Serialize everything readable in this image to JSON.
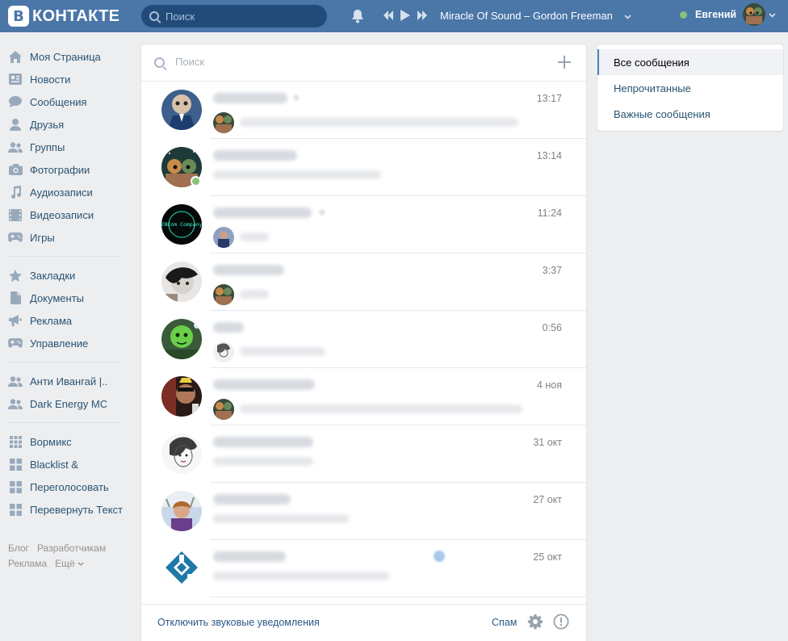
{
  "header": {
    "logo_letter": "В",
    "logo_text": "КОНТАКТЕ",
    "search_placeholder": "Поиск",
    "track": "Miracle Of Sound – Gordon Freeman",
    "user_name": "Евгений"
  },
  "sidebar": {
    "items": [
      {
        "label": "Моя Страница",
        "icon": "home-icon"
      },
      {
        "label": "Новости",
        "icon": "news-icon"
      },
      {
        "label": "Сообщения",
        "icon": "messages-icon"
      },
      {
        "label": "Друзья",
        "icon": "friends-icon"
      },
      {
        "label": "Группы",
        "icon": "groups-icon"
      },
      {
        "label": "Фотографии",
        "icon": "camera-icon"
      },
      {
        "label": "Аудиозаписи",
        "icon": "music-note-icon"
      },
      {
        "label": "Видеозаписи",
        "icon": "film-icon"
      },
      {
        "label": "Игры",
        "icon": "gamepad-icon"
      }
    ],
    "items2": [
      {
        "label": "Закладки",
        "icon": "star-icon"
      },
      {
        "label": "Документы",
        "icon": "document-icon"
      },
      {
        "label": "Реклама",
        "icon": "megaphone-icon"
      },
      {
        "label": "Управление",
        "icon": "gamepad-icon"
      }
    ],
    "groups": [
      {
        "label": "Анти Ивангай |..",
        "icon": "groups-icon"
      },
      {
        "label": "Dark Energy MC",
        "icon": "groups-icon"
      }
    ],
    "apps": [
      {
        "label": "Вормикс",
        "icon": "apps-grid-icon"
      },
      {
        "label": "Blacklist &",
        "icon": "apps-grid-icon"
      },
      {
        "label": "Переголосовать",
        "icon": "apps-grid-icon"
      },
      {
        "label": "Перевернуть Текст",
        "icon": "apps-grid-icon"
      }
    ],
    "footer": {
      "blog": "Блог",
      "dev": "Разработчикам",
      "ads": "Реклама",
      "more": "Ещё"
    }
  },
  "messages": {
    "search_placeholder": "Поиск",
    "dialogs": [
      {
        "time": "13:17"
      },
      {
        "time": "13:14"
      },
      {
        "time": "11:24"
      },
      {
        "time": "3:37"
      },
      {
        "time": "0:56"
      },
      {
        "time": "4 ноя"
      },
      {
        "time": "31 окт"
      },
      {
        "time": "27 окт"
      },
      {
        "time": "25 окт"
      }
    ],
    "footer": {
      "mute": "Отключить звуковые уведомления",
      "spam": "Спам"
    }
  },
  "right_menu": {
    "items": [
      "Все сообщения",
      "Непрочитанные",
      "Важные сообщения"
    ]
  },
  "colors": {
    "header_bg": "#4a76a8",
    "link": "#285473",
    "accent": "#5181b8",
    "online": "#8ac176"
  }
}
